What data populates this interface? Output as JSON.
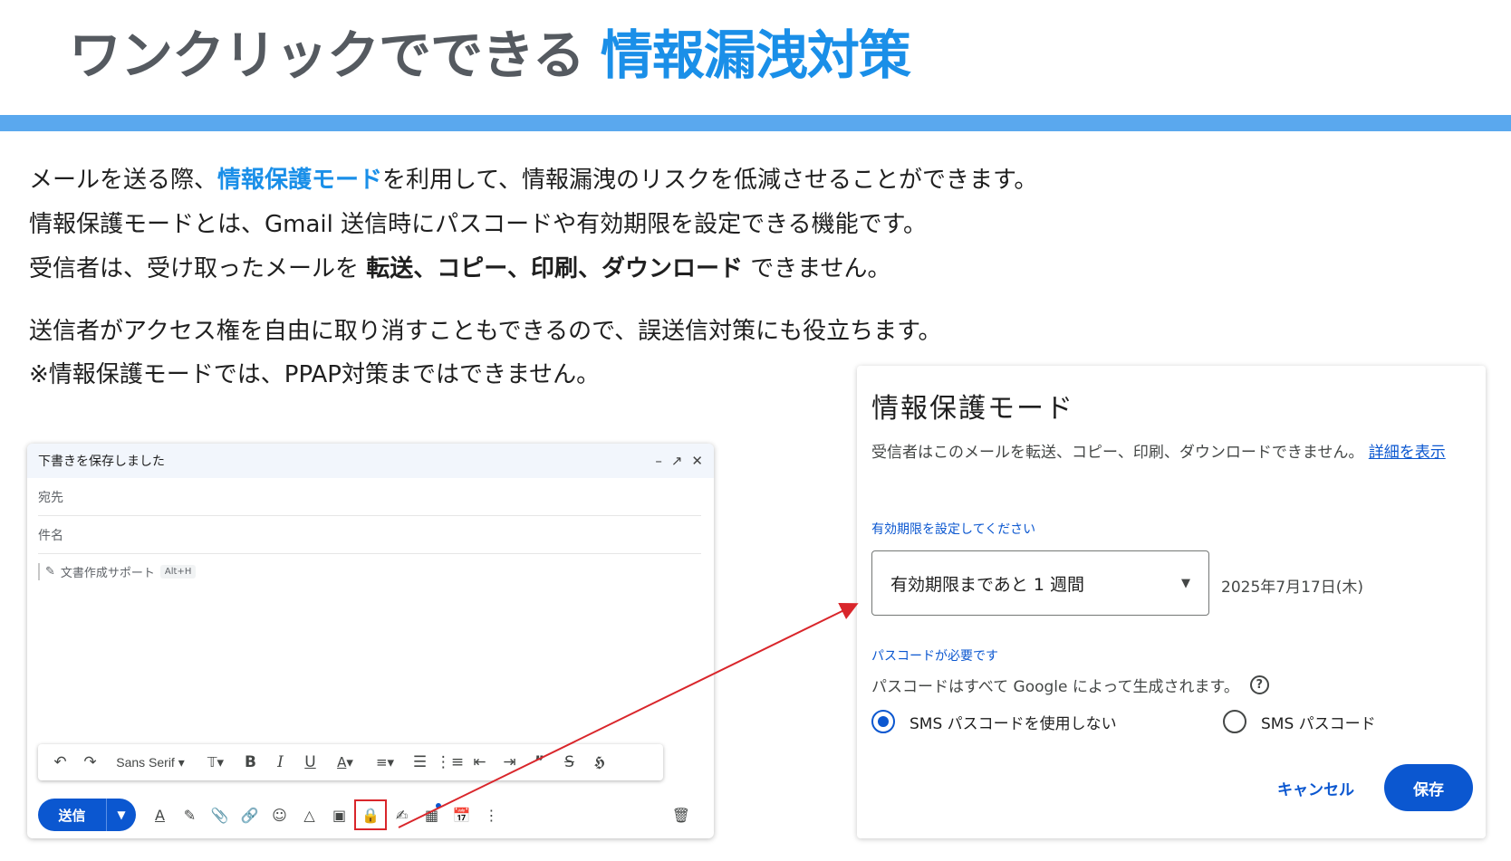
{
  "slide": {
    "title_dark": "ワンクリックでできる",
    "title_accent": "情報漏洩対策",
    "line1_a": "メールを送る際、",
    "line1_b": "情報保護モード",
    "line1_c": "を利用して、情報漏洩のリスクを低減させることができます。",
    "line2": "情報保護モードとは、Gmail 送信時にパスコードや有効期限を設定できる機能です。",
    "line3_a": "受信者は、受け取ったメールを ",
    "line3_b": "転送、コピー、印刷、ダウンロード",
    "line3_c": " できません。",
    "line4": "送信者がアクセス権を自由に取り消すこともできるので、誤送信対策にも役立ちます。",
    "line5": "※情報保護モードでは、PPAP対策まではできません。",
    "accent_color": "#1a8fe8",
    "bar_color": "#5aa8ee"
  },
  "compose": {
    "header_title": "下書きを保存しました",
    "minimize_icon": "minimize-icon",
    "expand_icon": "expand-icon",
    "close_icon": "close-icon",
    "to_placeholder": "宛先",
    "subject_placeholder": "件名",
    "assist_label": "文書作成サポート",
    "assist_shortcut": "Alt+H",
    "font_name": "Sans Serif",
    "send_label": "送信"
  },
  "dialog": {
    "title": "情報保護モード",
    "description": "受信者はこのメールを転送、コピー、印刷、ダウンロードできません。",
    "details_link": "詳細を表示",
    "expiry_label": "有効期限を設定してください",
    "expiry_value": "有効期限まであと 1 週間",
    "expiry_date": "2025年7月17日(木)",
    "passcode_label": "パスコードが必要です",
    "passcode_note": "パスコードはすべて Google によって生成されます。",
    "option_no_sms": "SMS パスコードを使用しない",
    "option_sms": "SMS パスコード",
    "selected_option": "SMS パスコードを使用しない",
    "cancel_label": "キャンセル",
    "save_label": "保存",
    "primary_color": "#0b57d0"
  }
}
